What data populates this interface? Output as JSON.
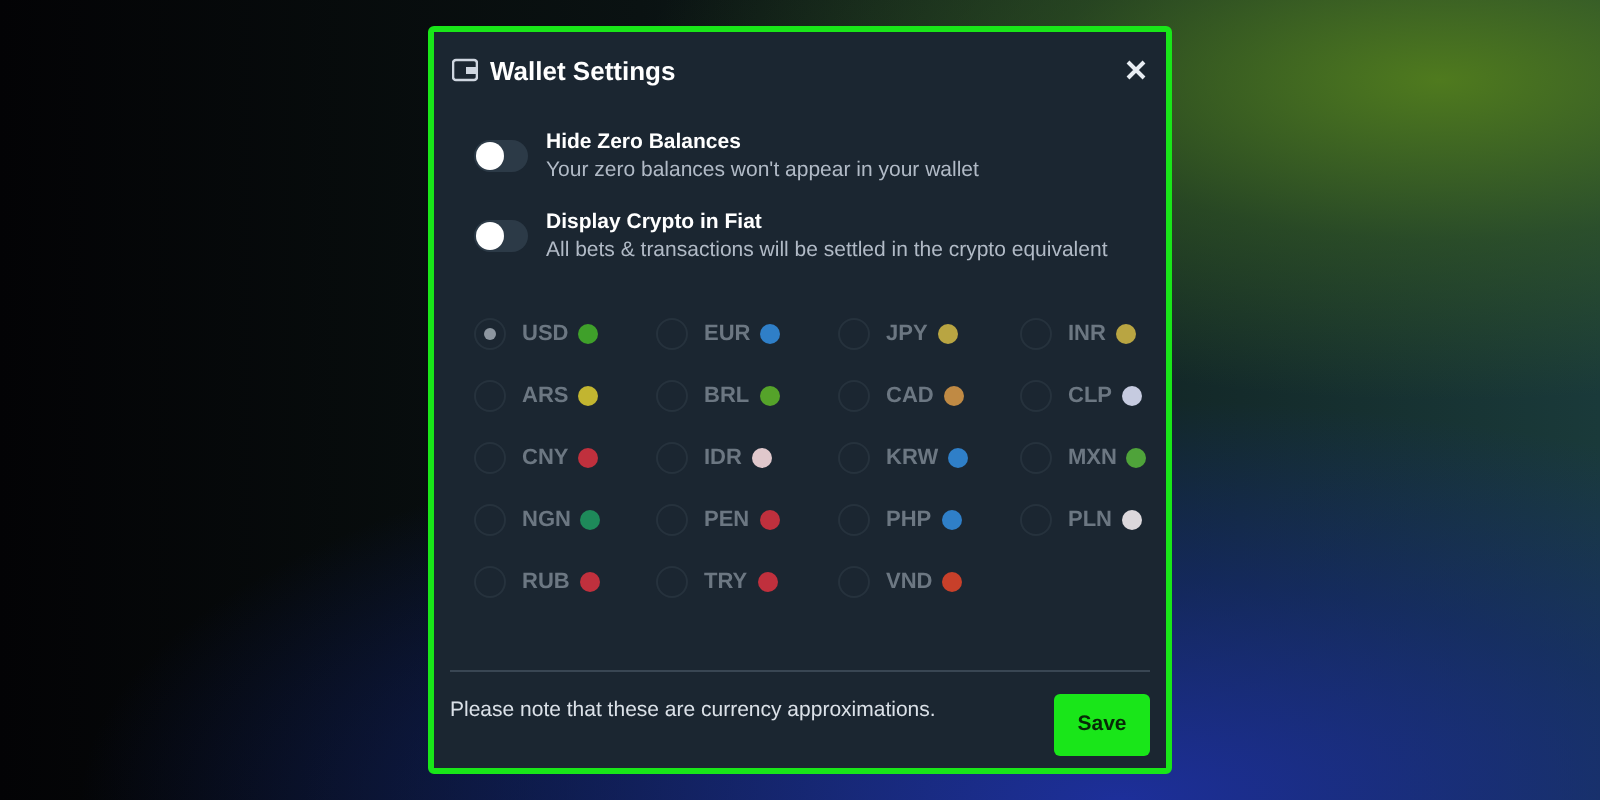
{
  "dialog": {
    "title": "Wallet Settings"
  },
  "toggles": [
    {
      "label": "Hide Zero Balances",
      "description": "Your zero balances won't appear in your wallet",
      "on": false
    },
    {
      "label": "Display Crypto in Fiat",
      "description": "All bets & transactions will be settled in the crypto equivalent",
      "on": false
    }
  ],
  "currencies_disabled": true,
  "currencies": [
    {
      "code": "USD",
      "selected": true,
      "color": "#3fa02a"
    },
    {
      "code": "EUR",
      "selected": false,
      "color": "#2f7fc8"
    },
    {
      "code": "JPY",
      "selected": false,
      "color": "#b9a542"
    },
    {
      "code": "INR",
      "selected": false,
      "color": "#b9a542"
    },
    {
      "code": "ARS",
      "selected": false,
      "color": "#c2b530"
    },
    {
      "code": "BRL",
      "selected": false,
      "color": "#55a32a"
    },
    {
      "code": "CAD",
      "selected": false,
      "color": "#c08a44"
    },
    {
      "code": "CLP",
      "selected": false,
      "color": "#c6cbe0"
    },
    {
      "code": "CNY",
      "selected": false,
      "color": "#c0303d"
    },
    {
      "code": "IDR",
      "selected": false,
      "color": "#e0c8cc"
    },
    {
      "code": "KRW",
      "selected": false,
      "color": "#2f7fc8"
    },
    {
      "code": "MXN",
      "selected": false,
      "color": "#4fa33a"
    },
    {
      "code": "NGN",
      "selected": false,
      "color": "#1e8a5a"
    },
    {
      "code": "PEN",
      "selected": false,
      "color": "#c0303d"
    },
    {
      "code": "PHP",
      "selected": false,
      "color": "#2f7fc8"
    },
    {
      "code": "PLN",
      "selected": false,
      "color": "#dcd8dc"
    },
    {
      "code": "RUB",
      "selected": false,
      "color": "#c0303d"
    },
    {
      "code": "TRY",
      "selected": false,
      "color": "#c0303d"
    },
    {
      "code": "VND",
      "selected": false,
      "color": "#c8402a"
    }
  ],
  "footer": {
    "note": "Please note that these are currency approximations.",
    "button": "Save"
  }
}
